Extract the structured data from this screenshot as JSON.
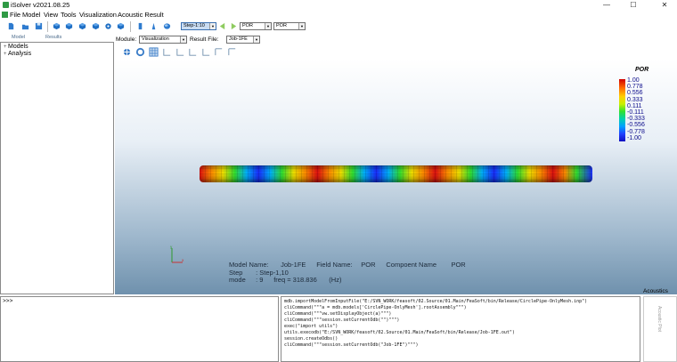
{
  "window": {
    "title": "iSolver v2021.08.25",
    "minimize": "—",
    "maximize": "☐",
    "close": "✕"
  },
  "menu": [
    "File",
    "Model",
    "View",
    "Tools",
    "Visualization",
    "Acoustic Result"
  ],
  "toolbar": {
    "step_combo": "Step-1:10",
    "field_combo_1": "POR",
    "field_combo_2": "POR",
    "icons": [
      "new-file",
      "open-file",
      "save",
      "cube-1",
      "cube-2",
      "cube-3",
      "cube-4",
      "gear-cube",
      "cube-5",
      "column-1",
      "column-2",
      "column-3",
      "sphere",
      "prev-step",
      "first-frame",
      "next-step"
    ]
  },
  "left_tabs": [
    "Model",
    "Results"
  ],
  "tree": [
    {
      "label": "Models",
      "expander": "+"
    },
    {
      "label": "Analysis",
      "expander": "+"
    }
  ],
  "module_bar": {
    "module_label": "Module:",
    "module_value": "Visualization",
    "result_label": "Result File:",
    "result_value": "Job-1FE"
  },
  "view_toolbar": [
    "pan-rotate",
    "refresh",
    "grid-mesh",
    "view-1",
    "view-2",
    "view-3",
    "view-4",
    "view-5",
    "view-6"
  ],
  "legend": {
    "title": "POR",
    "values": [
      "1.00",
      "0.778",
      "0.556",
      "0.333",
      "0.111",
      "-0.111",
      "-0.333",
      "-0.556",
      "-0.778",
      "-1.00"
    ]
  },
  "info": {
    "model_label": "Model Name:",
    "model_value": "Job-1FE",
    "field_label": "Field Name:",
    "field_value": "POR",
    "component_label": "Compoent Name",
    "component_value": "POR",
    "step_label": "Step",
    "step_value": ": Step-1,10",
    "mode_label": "mode",
    "mode_value": ": 9",
    "freq_label": "freq = 318.836",
    "freq_unit": "(Hz)"
  },
  "axes": {
    "x": "x",
    "y": "y"
  },
  "console": {
    "prompt": ">>>"
  },
  "script_lines": [
    "mdb.importModelFromInputFile(\"E:/SVN_WORK/feasoft/02.Source/01.Main/FeaSoft/bin/Release/CirclePipe-OnlyMesh.inp\")",
    "cliCommand(\"\"\"a = mdb.models['CirclePipe-OnlyMesh'].rootAssembly\"\"\")",
    "cliCommand(\"\"\"vw.setDisplayObject(a)\"\"\")",
    "cliCommand(\"\"\"session.setCurrentOdb(\"\")\"\"\")",
    "exec(\"import utils\")",
    "utils.execodb(\"E:/SVN_WORK/feasoft/02.Source/01.Main/FeaSoft/bin/Release/Job-1FE.out\")",
    "session.createOdbs()",
    "cliCommand(\"\"\"session.setCurrentOdb(\"Job-1FE\")\"\"\")"
  ],
  "right_panel": {
    "tab": "Acoustics",
    "vertical": "Acoustic Plot"
  }
}
